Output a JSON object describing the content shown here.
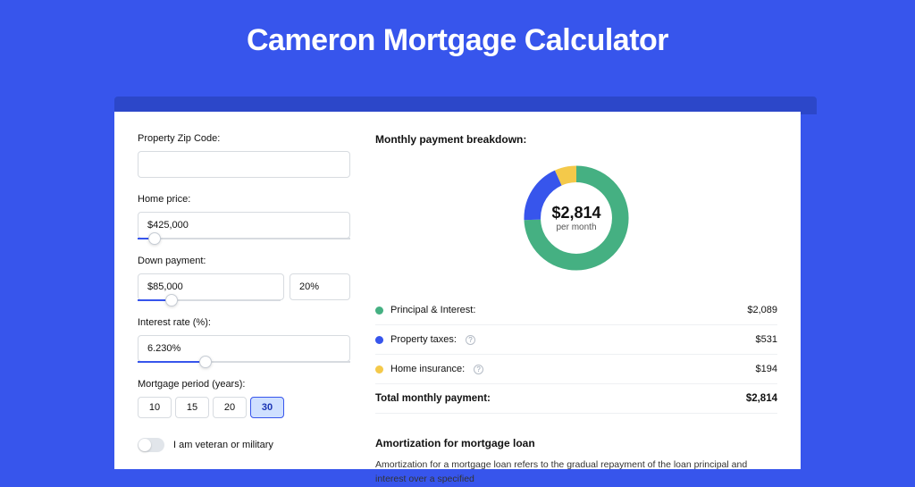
{
  "title": "Cameron Mortgage Calculator",
  "form": {
    "zip_label": "Property Zip Code:",
    "zip_value": "",
    "price_label": "Home price:",
    "price_value": "$425,000",
    "price_slider_pct": 8,
    "down_label": "Down payment:",
    "down_value": "$85,000",
    "down_percent": "20%",
    "down_slider_pct": 24,
    "rate_label": "Interest rate (%):",
    "rate_value": "6.230%",
    "rate_slider_pct": 32,
    "period_label": "Mortgage period (years):",
    "periods": [
      {
        "label": "10",
        "active": false
      },
      {
        "label": "15",
        "active": false
      },
      {
        "label": "20",
        "active": false
      },
      {
        "label": "30",
        "active": true
      }
    ],
    "veteran_label": "I am veteran or military",
    "veteran_on": false
  },
  "breakdown": {
    "title": "Monthly payment breakdown:",
    "total_display": "$2,814",
    "total_sub": "per month",
    "items": [
      {
        "label": "Principal & Interest:",
        "value": "$2,089",
        "color": "#45b082",
        "has_info": false
      },
      {
        "label": "Property taxes:",
        "value": "$531",
        "color": "#3755ec",
        "has_info": true
      },
      {
        "label": "Home insurance:",
        "value": "$194",
        "color": "#f4c94a",
        "has_info": true
      }
    ],
    "total_label": "Total monthly payment:",
    "total_value": "$2,814"
  },
  "amort": {
    "title": "Amortization for mortgage loan",
    "text": "Amortization for a mortgage loan refers to the gradual repayment of the loan principal and interest over a specified"
  },
  "chart_data": {
    "type": "pie",
    "title": "Monthly payment breakdown",
    "series": [
      {
        "name": "Principal & Interest",
        "value": 2089,
        "color": "#45b082"
      },
      {
        "name": "Property taxes",
        "value": 531,
        "color": "#3755ec"
      },
      {
        "name": "Home insurance",
        "value": 194,
        "color": "#f4c94a"
      }
    ],
    "total": 2814,
    "center_label": "$2,814 per month"
  }
}
